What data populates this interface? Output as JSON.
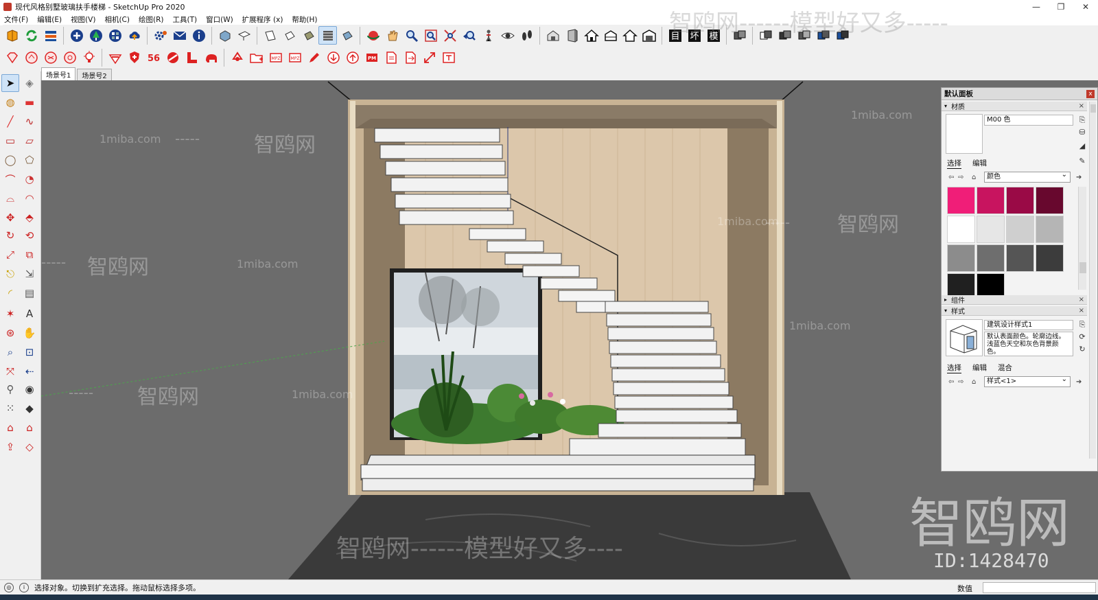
{
  "window": {
    "title": "现代风格别墅玻璃扶手楼梯 - SketchUp Pro 2020",
    "controls": [
      "—",
      "❐",
      "✕"
    ]
  },
  "menu": [
    "文件(F)",
    "编辑(E)",
    "视图(V)",
    "相机(C)",
    "绘图(R)",
    "工具(T)",
    "窗口(W)",
    "扩展程序 (x)",
    "帮助(H)"
  ],
  "toolbar_row1": {
    "group_a": [
      "get-models-icon",
      "refresh-icon",
      "layers-stack-icon",
      "add-circle-icon",
      "tree-icon",
      "checker-ball-icon",
      "cloud-upload-icon",
      "gear-icon",
      "mail-icon",
      "info-icon"
    ],
    "group_b": [
      "iso-view-icon",
      "top-view-icon",
      "front-view-icon",
      "right-view-icon",
      "back-view-icon",
      "left-view-icon",
      "bottom-view-icon"
    ],
    "group_c": [
      "orbit-icon",
      "pan-icon",
      "zoom-icon",
      "zoom-window-icon",
      "zoom-extents-icon",
      "previous-view-icon",
      "position-camera-icon",
      "look-around-icon",
      "walk-icon"
    ],
    "group_d": [
      "house-section-icon",
      "door-icon",
      "home-icon",
      "house-iso-icon",
      "house-outline-icon",
      "warehouse-icon"
    ],
    "text_buttons": [
      "目",
      "坏",
      "模"
    ],
    "group_e": [
      "box-1-icon",
      "box-2-icon",
      "box-3-icon",
      "box-4-icon",
      "box-5-icon",
      "box-6-icon"
    ]
  },
  "toolbar_row2": {
    "group_a": [
      "gem-icon",
      "sticker-1-icon",
      "sticker-2-icon",
      "sticker-3-icon",
      "bulb-icon"
    ],
    "group_b": [
      "rsc-icon",
      "shield-icon",
      "number-56-icon",
      "disc-icon",
      "l-tool-icon",
      "elephant-icon"
    ],
    "group_c": [
      "recycle-icon",
      "folder-add-icon",
      "mpz-icon",
      "mpz-export-icon",
      "pencil-icon",
      "circle-down-icon",
      "circle-up-icon",
      "pm-icon",
      "doc-icon",
      "doc-export-icon",
      "expand-icon",
      "text-edit-icon"
    ],
    "labels": {
      "mpz": "MPZ",
      "pm": "PM"
    }
  },
  "left_toolbar": [
    "select-icon",
    "component-icon",
    "paint-bucket-icon",
    "eraser-icon",
    "line-icon",
    "freehand-icon",
    "rectangle-icon",
    "rotated-rect-icon",
    "circle-icon",
    "polygon-icon",
    "arc-icon",
    "pie-icon",
    "arc-2pt-icon",
    "arc-3pt-icon",
    "move-icon",
    "push-pull-icon",
    "rotate-icon",
    "follow-me-icon",
    "scale-icon",
    "offset-icon",
    "tape-measure-icon",
    "dimension-icon",
    "protractor-icon",
    "text-icon",
    "axes-icon",
    "3d-text-icon",
    "orbit-icon",
    "pan-icon",
    "zoom-icon",
    "zoom-window-icon",
    "zoom-extents-icon",
    "previous-icon",
    "position-camera-icon",
    "look-around-icon",
    "walk-icon",
    "section-plane-icon",
    "warehouse-1-icon",
    "warehouse-2-icon",
    "share-model-icon",
    "extension-warehouse-icon"
  ],
  "scenes": {
    "tabs": [
      "场景号1",
      "场景号2"
    ],
    "active": 0
  },
  "tray": {
    "title": "默认面板",
    "close": "x",
    "materials": {
      "section": "材质",
      "current_name": "M00 色",
      "tabs": [
        "选择",
        "编辑"
      ],
      "active_tab": 0,
      "library": "颜色",
      "colors": [
        "#f01e78",
        "#c8145f",
        "#9a0a46",
        "#68082e",
        "#ffffff",
        "#e6e6e6",
        "#cfcfcf",
        "#b5b5b5",
        "#8c8c8c",
        "#6e6e6e",
        "#555555",
        "#3c3c3c",
        "#202020",
        "#000000"
      ]
    },
    "components": {
      "section": "组件"
    },
    "styles": {
      "section": "样式",
      "name": "建筑设计样式1",
      "description": "默认表面颜色。轮廓边线。浅蓝色天空和灰色背景颜色。",
      "tabs": [
        "选择",
        "编辑",
        "混合"
      ],
      "active_tab": 0,
      "library": "样式<1>"
    },
    "collapse_marks": {
      "open": "▾",
      "closed": "▸",
      "close": "×"
    }
  },
  "viewport": {
    "background": "#6c6c6c",
    "wood": "#d8c3a8",
    "marble": "#f1f1f1",
    "floor": "#3d3d3d"
  },
  "status": {
    "message": "选择对象。切换到扩充选择。拖动鼠标选择多项。",
    "measure_label": "数值",
    "measure_value": ""
  },
  "watermarks": {
    "header": "智鸥网------模型好又多-----",
    "site": "1miba.com",
    "dash": "-----",
    "brand": "智鸥网",
    "bottom": "智鸥网------模型好又多----",
    "logo": "智鸥网",
    "id": "ID:1428470"
  }
}
